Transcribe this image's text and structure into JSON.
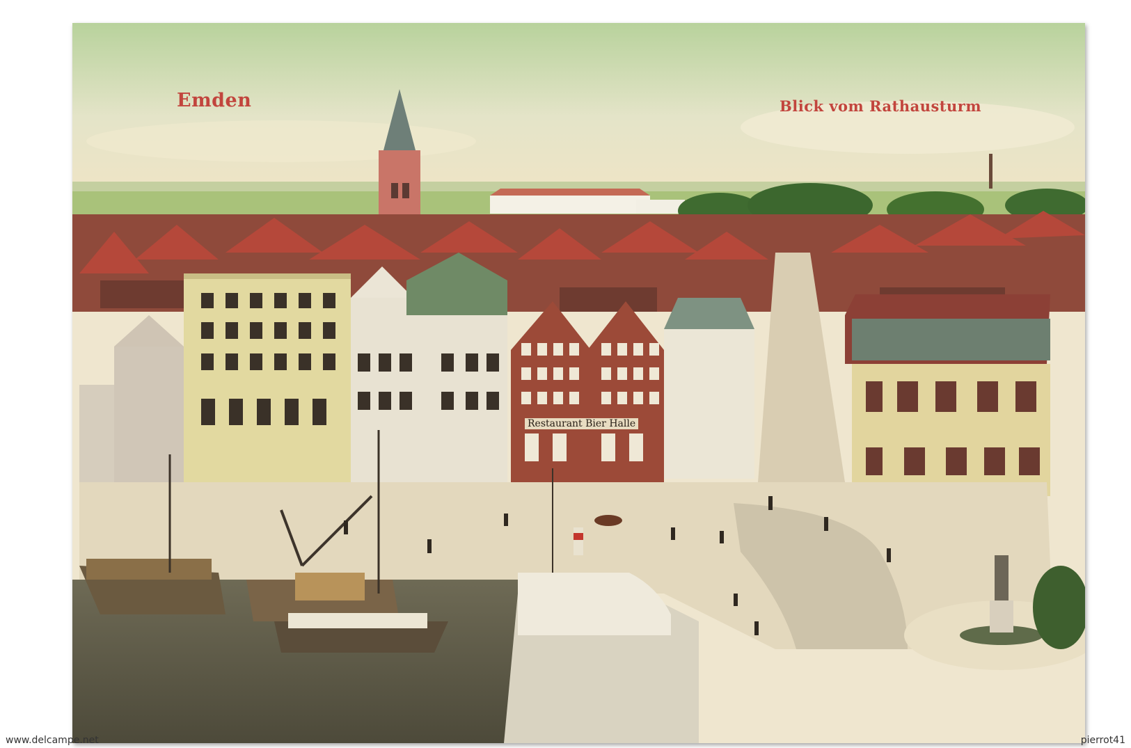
{
  "postcard": {
    "city_caption": "Emden",
    "view_caption": "Blick vom Rathausturm",
    "shop_sign": "Restaurant  Bier Halle"
  },
  "footer": {
    "left": "www.delcampe.net",
    "right": "pierrot41"
  },
  "colors": {
    "caption_red": "#c2453d",
    "sky": "#c8d8b0",
    "roofs": "#a8453a",
    "square": "#e3d8bd"
  }
}
